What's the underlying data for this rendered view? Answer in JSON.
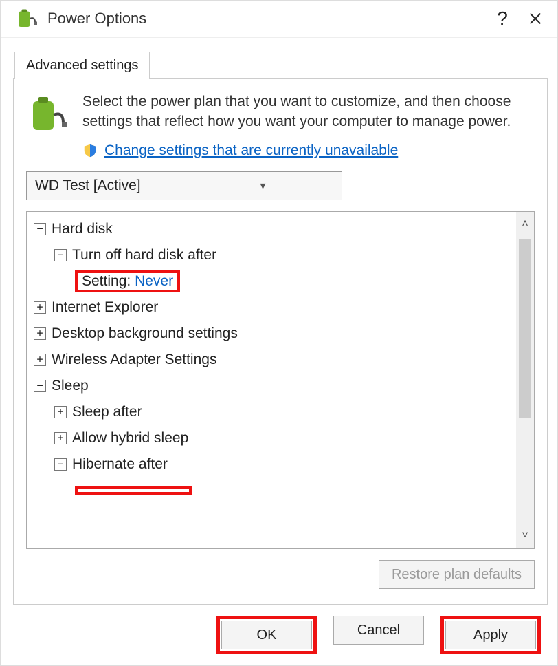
{
  "title": "Power Options",
  "tab_label": "Advanced settings",
  "intro": "Select the power plan that you want to customize, and then choose settings that reflect how you want your computer to manage power.",
  "shield_link": "Change settings that are currently unavailable",
  "plan_selected": "WD Test [Active]",
  "tree": {
    "hard_disk": "Hard disk",
    "turn_off": "Turn off hard disk after",
    "setting_label": "Setting: ",
    "setting_value": "Never",
    "ie": "Internet Explorer",
    "desktop_bg": "Desktop background settings",
    "wireless": "Wireless Adapter Settings",
    "sleep": "Sleep",
    "sleep_after": "Sleep after",
    "hybrid": "Allow hybrid sleep",
    "hibernate": "Hibernate after"
  },
  "restore_btn": "Restore plan defaults",
  "ok_btn": "OK",
  "cancel_btn": "Cancel",
  "apply_btn": "Apply"
}
